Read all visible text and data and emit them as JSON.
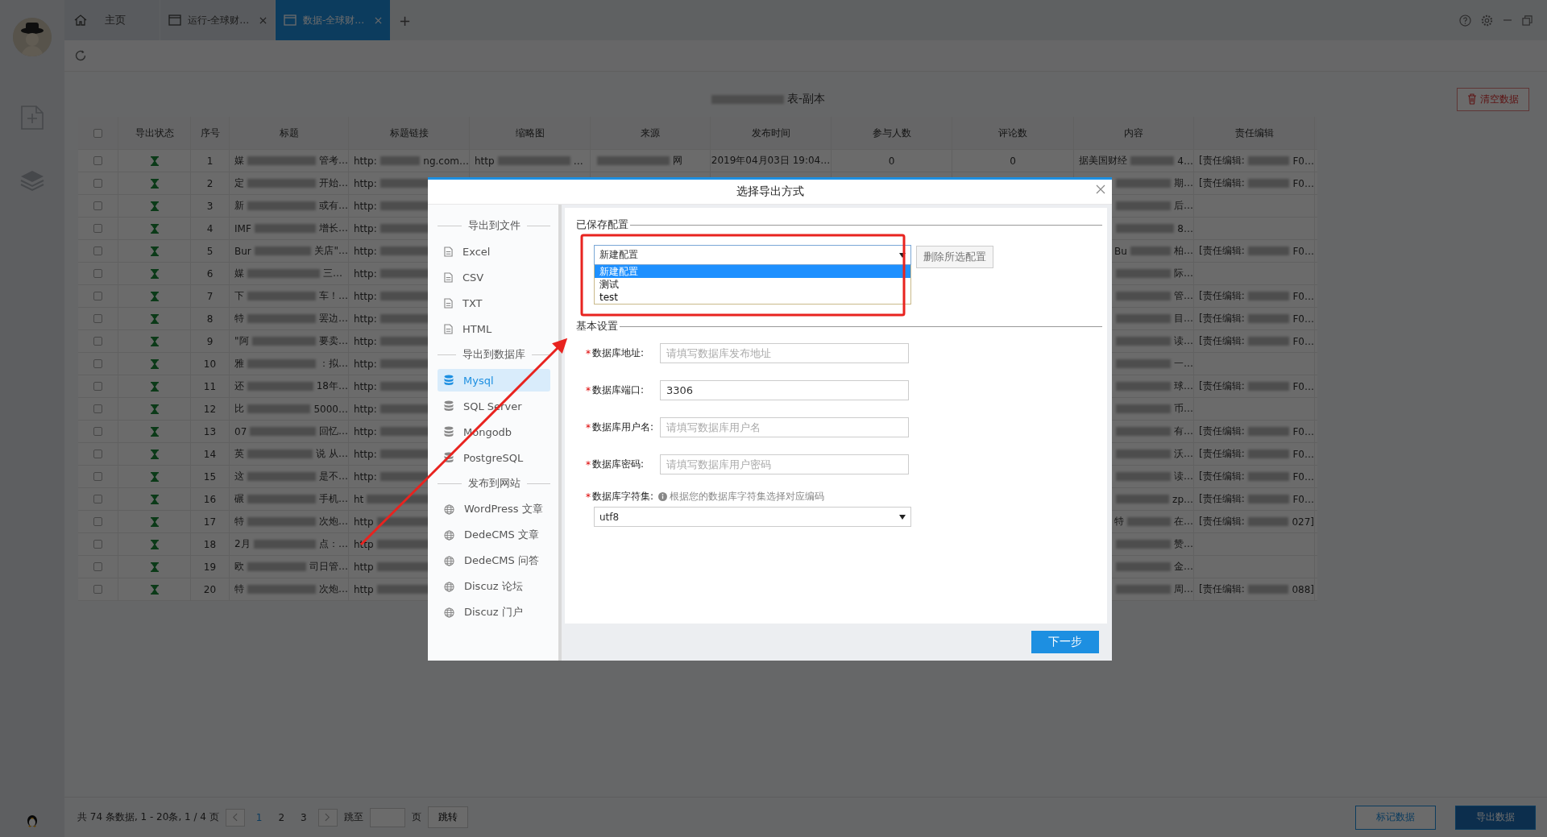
{
  "tabs": [
    {
      "kind": "home",
      "label": "主页",
      "selected": false,
      "closable": false
    },
    {
      "kind": "page",
      "label": "运行-全球财…",
      "selected": false,
      "closable": true
    },
    {
      "kind": "page",
      "label": "数据-全球财…",
      "selected": true,
      "closable": true
    }
  ],
  "tab_add": "+",
  "page_title": {
    "tail": "表-副本"
  },
  "clear_button": "清空数据",
  "table": {
    "header_checked": false,
    "columns": [
      "导出状态",
      "序号",
      "标题",
      "标题链接",
      "缩略图",
      "来源",
      "发布时间",
      "参与人数",
      "评论数",
      "内容",
      "责任编辑"
    ],
    "rows": [
      {
        "checked": false,
        "index": "1",
        "title": {
          "head": "媒",
          "tail": "管考…"
        },
        "link": {
          "head": "http:",
          "tail": "ng.com…"
        },
        "thumbnail": {
          "head": "http",
          "tail": "…"
        },
        "source": {
          "tail": "网"
        },
        "time": "2019年04月03日 19:04…",
        "participants": "0",
        "comments": "0",
        "content": {
          "head": "据美国财经",
          "tail": "4…"
        },
        "editor": {
          "head": "[责任编辑:",
          "tail": "F0…"
        }
      },
      {
        "checked": false,
        "index": "2",
        "title": {
          "head": "定",
          "tail": "开始…"
        },
        "link": {
          "head": "http:"
        },
        "content": {
          "tail": "期…"
        },
        "editor": {
          "head": "[责任编辑:",
          "tail": "F0…"
        }
      },
      {
        "checked": false,
        "index": "3",
        "title": {
          "head": "新",
          "tail": "或有…"
        },
        "link": {
          "head": "http:"
        },
        "content": {
          "tail": "后…"
        }
      },
      {
        "checked": false,
        "index": "4",
        "title": {
          "head": "IMF",
          "tail": "增长…"
        },
        "link": {
          "head": "http:"
        },
        "content": {
          "tail": "8…"
        }
      },
      {
        "checked": false,
        "index": "5",
        "title": {
          "head": "Bur",
          "tail": "关店\"…"
        },
        "link": {
          "head": "http:"
        },
        "content": {
          "head": "Bu",
          "tail": "柏…"
        },
        "editor": {
          "head": "[责任编辑:",
          "tail": "F0…"
        }
      },
      {
        "checked": false,
        "index": "6",
        "title": {
          "head": "媒",
          "tail": "三…"
        },
        "link": {
          "head": "http:"
        },
        "content": {
          "tail": "际…"
        }
      },
      {
        "checked": false,
        "index": "7",
        "title": {
          "head": "下",
          "tail": "车！…"
        },
        "link": {
          "head": "http:"
        },
        "content": {
          "tail": "管…"
        },
        "editor": {
          "head": "[责任编辑:",
          "tail": "F0…"
        }
      },
      {
        "checked": false,
        "index": "8",
        "title": {
          "head": "特",
          "tail": "罢边…"
        },
        "link": {
          "head": "http:"
        },
        "content": {
          "tail": "目…"
        },
        "editor": {
          "head": "[责任编辑:",
          "tail": "F0…"
        }
      },
      {
        "checked": false,
        "index": "9",
        "title": {
          "head": "\"阿",
          "tail": "要卖…"
        },
        "link": {
          "head": "http:"
        },
        "content": {
          "tail": "读…"
        },
        "editor": {
          "head": "[责任编辑:",
          "tail": "F0…"
        }
      },
      {
        "checked": false,
        "index": "10",
        "title": {
          "head": "雅",
          "tail": "：拟…"
        },
        "link": {
          "head": "http:"
        },
        "content": {
          "tail": "一…"
        }
      },
      {
        "checked": false,
        "index": "11",
        "title": {
          "head": "还",
          "tail": "18年…"
        },
        "link": {
          "head": "http:"
        },
        "content": {
          "tail": "球…"
        },
        "editor": {
          "head": "[责任编辑:",
          "tail": "F0…"
        }
      },
      {
        "checked": false,
        "index": "12",
        "title": {
          "head": "比",
          "tail": "5000…"
        },
        "link": {
          "head": "http:"
        },
        "content": {
          "tail": "币…"
        }
      },
      {
        "checked": false,
        "index": "13",
        "title": {
          "head": "07",
          "tail": "回忆…"
        },
        "link": {
          "head": "http:"
        },
        "content": {
          "tail": "有…"
        },
        "editor": {
          "head": "[责任编辑:",
          "tail": "F0…"
        }
      },
      {
        "checked": false,
        "index": "14",
        "title": {
          "head": "英",
          "tail": "说 从…"
        },
        "link": {
          "head": "http:"
        },
        "content": {
          "tail": "沃…"
        },
        "editor": {
          "head": "[责任编辑:",
          "tail": "F0…"
        }
      },
      {
        "checked": false,
        "index": "15",
        "title": {
          "head": "这",
          "tail": "是不…"
        },
        "link": {
          "head": "http:"
        },
        "content": {
          "tail": "读…"
        },
        "editor": {
          "head": "[责任编辑:",
          "tail": "F0…"
        }
      },
      {
        "checked": false,
        "index": "16",
        "title": {
          "head": "碾",
          "tail": "手机…"
        },
        "link": {
          "head": "ht"
        },
        "content": {
          "tail": "zp…"
        },
        "editor": {
          "head": "[责任编辑:",
          "tail": "F0…"
        }
      },
      {
        "checked": false,
        "index": "17",
        "title": {
          "head": "特",
          "tail": "次炮…"
        },
        "link": {
          "head": "http"
        },
        "content": {
          "head": "特",
          "tail": "在…"
        },
        "editor": {
          "head": "[责任编辑:",
          "tail": "027]"
        }
      },
      {
        "checked": false,
        "index": "18",
        "title": {
          "head": "2月",
          "tail": "点：…"
        },
        "link": {
          "head": "http"
        },
        "content": {
          "tail": "赞…"
        }
      },
      {
        "checked": false,
        "index": "19",
        "title": {
          "head": "欧",
          "tail": "司日管…"
        },
        "link": {
          "head": "http"
        },
        "content": {
          "tail": "金…"
        }
      },
      {
        "checked": false,
        "index": "20",
        "title": {
          "head": "特",
          "tail": "次炮…"
        },
        "link": {
          "head": "http"
        },
        "content": {
          "tail": "周…"
        },
        "editor": {
          "head": "[责任编辑:",
          "tail": "088]"
        }
      }
    ]
  },
  "pager": {
    "summary": "共 74 条数据, 1 - 20条, 1 / 4 页",
    "pages": [
      {
        "label": "1",
        "selected": true
      },
      {
        "label": "2",
        "selected": false
      },
      {
        "label": "3",
        "selected": false
      }
    ],
    "goto_label": "跳至",
    "page_unit": "页",
    "goto_button": "跳转"
  },
  "footer_buttons": [
    {
      "label": "标记数据",
      "kind": "outline"
    },
    {
      "label": "导出数据",
      "kind": "primary"
    }
  ],
  "dialog": {
    "title": "选择导出方式",
    "nav": [
      {
        "kind": "heading",
        "label": "导出到文件"
      },
      {
        "kind": "file",
        "label": "Excel",
        "selected": false
      },
      {
        "kind": "file",
        "label": "CSV",
        "selected": false
      },
      {
        "kind": "file",
        "label": "TXT",
        "selected": false
      },
      {
        "kind": "file",
        "label": "HTML",
        "selected": false
      },
      {
        "kind": "heading",
        "label": "导出到数据库"
      },
      {
        "kind": "database",
        "label": "Mysql",
        "selected": true
      },
      {
        "kind": "database",
        "label": "SQL Server",
        "selected": false
      },
      {
        "kind": "database",
        "label": "Mongodb",
        "selected": false
      },
      {
        "kind": "database",
        "label": "PostgreSQL",
        "selected": false
      },
      {
        "kind": "heading",
        "label": "发布到网站"
      },
      {
        "kind": "website",
        "label": "WordPress 文章",
        "selected": false
      },
      {
        "kind": "website",
        "label": "DedeCMS 文章",
        "selected": false
      },
      {
        "kind": "website",
        "label": "DedeCMS 问答",
        "selected": false
      },
      {
        "kind": "website",
        "label": "Discuz 论坛",
        "selected": false
      },
      {
        "kind": "website",
        "label": "Discuz 门户",
        "selected": false
      }
    ],
    "saved_config": {
      "legend": "已保存配置",
      "select_value": "新建配置",
      "options": [
        {
          "label": "新建配置",
          "selected": true
        },
        {
          "label": "测试",
          "selected": false
        },
        {
          "label": "test",
          "selected": false
        }
      ],
      "delete_button": "删除所选配置"
    },
    "basic": {
      "legend": "基本设置",
      "fields": [
        {
          "mark": "*",
          "label": "数据库地址:",
          "placeholder": "请填写数据库发布地址"
        },
        {
          "mark": "*",
          "label": "数据库端口:",
          "value": "3306"
        },
        {
          "mark": "*",
          "label": "数据库用户名:",
          "placeholder": "请填写数据库用户名"
        },
        {
          "mark": "*",
          "label": "数据库密码:",
          "placeholder": "请填写数据库用户密码"
        }
      ],
      "charset": {
        "mark": "*",
        "label": "数据库字符集:",
        "hint": "根据您的数据库字符集选择对应编码",
        "value": "utf8"
      }
    },
    "next_button": "下一步"
  }
}
